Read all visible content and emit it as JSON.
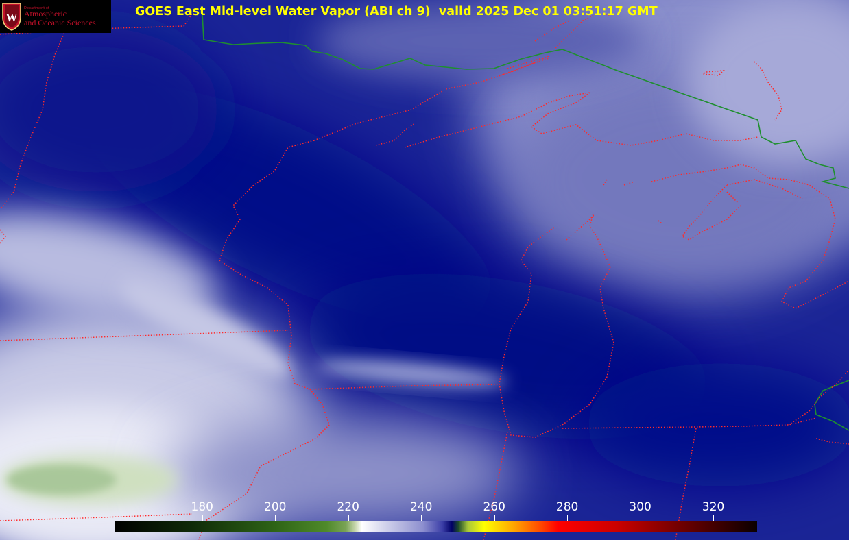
{
  "title": "GOES East Mid-level Water Vapor (ABI ch 9)  valid 2025 Dec 01 03:51:17 GMT",
  "logo": {
    "department": "Department of",
    "line1": "Atmospheric",
    "line2": "and Oceanic Sciences",
    "seal_letter": "W"
  },
  "colorbar": {
    "min": 156,
    "max": 332,
    "ticks": [
      {
        "value": 180,
        "label": "180"
      },
      {
        "value": 200,
        "label": "200"
      },
      {
        "value": 220,
        "label": "220"
      },
      {
        "value": 240,
        "label": "240"
      },
      {
        "value": 260,
        "label": "260"
      },
      {
        "value": 280,
        "label": "280"
      },
      {
        "value": 300,
        "label": "300"
      },
      {
        "value": 320,
        "label": "320"
      }
    ]
  },
  "colors": {
    "title": "#ffff00",
    "state_borders": "#ff2a2a",
    "country_border": "#1f8f2f",
    "logo_background": "#000000",
    "logo_text": "#c4102a",
    "deep_vapor": "#000e88"
  }
}
